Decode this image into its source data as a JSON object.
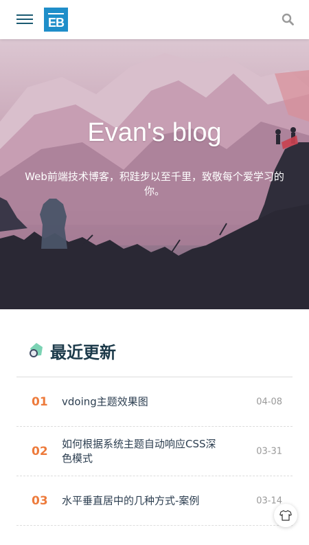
{
  "navbar": {
    "logo_text": "EB",
    "menu_icon": "hamburger-menu-icon",
    "search_icon": "search-icon"
  },
  "hero": {
    "title": "Evan's blog",
    "description": "Web前端技术博客，积跬步以至千里，致敬每个爱学习的你。"
  },
  "recent": {
    "title": "最近更新",
    "icon": "badge-icon",
    "posts": [
      {
        "no": "01",
        "title": "vdoing主题效果图",
        "date": "04-08"
      },
      {
        "no": "02",
        "title": "如何根据系统主题自动响应CSS深色模式",
        "date": "03-31"
      },
      {
        "no": "03",
        "title": "水平垂直居中的几种方式-案例",
        "date": "03-14"
      }
    ]
  },
  "theme_button": {
    "icon": "tshirt-icon"
  },
  "colors": {
    "accent": "#ed7b3c",
    "brand": "#1f8ec9",
    "title_dark": "#1c3a4a"
  }
}
